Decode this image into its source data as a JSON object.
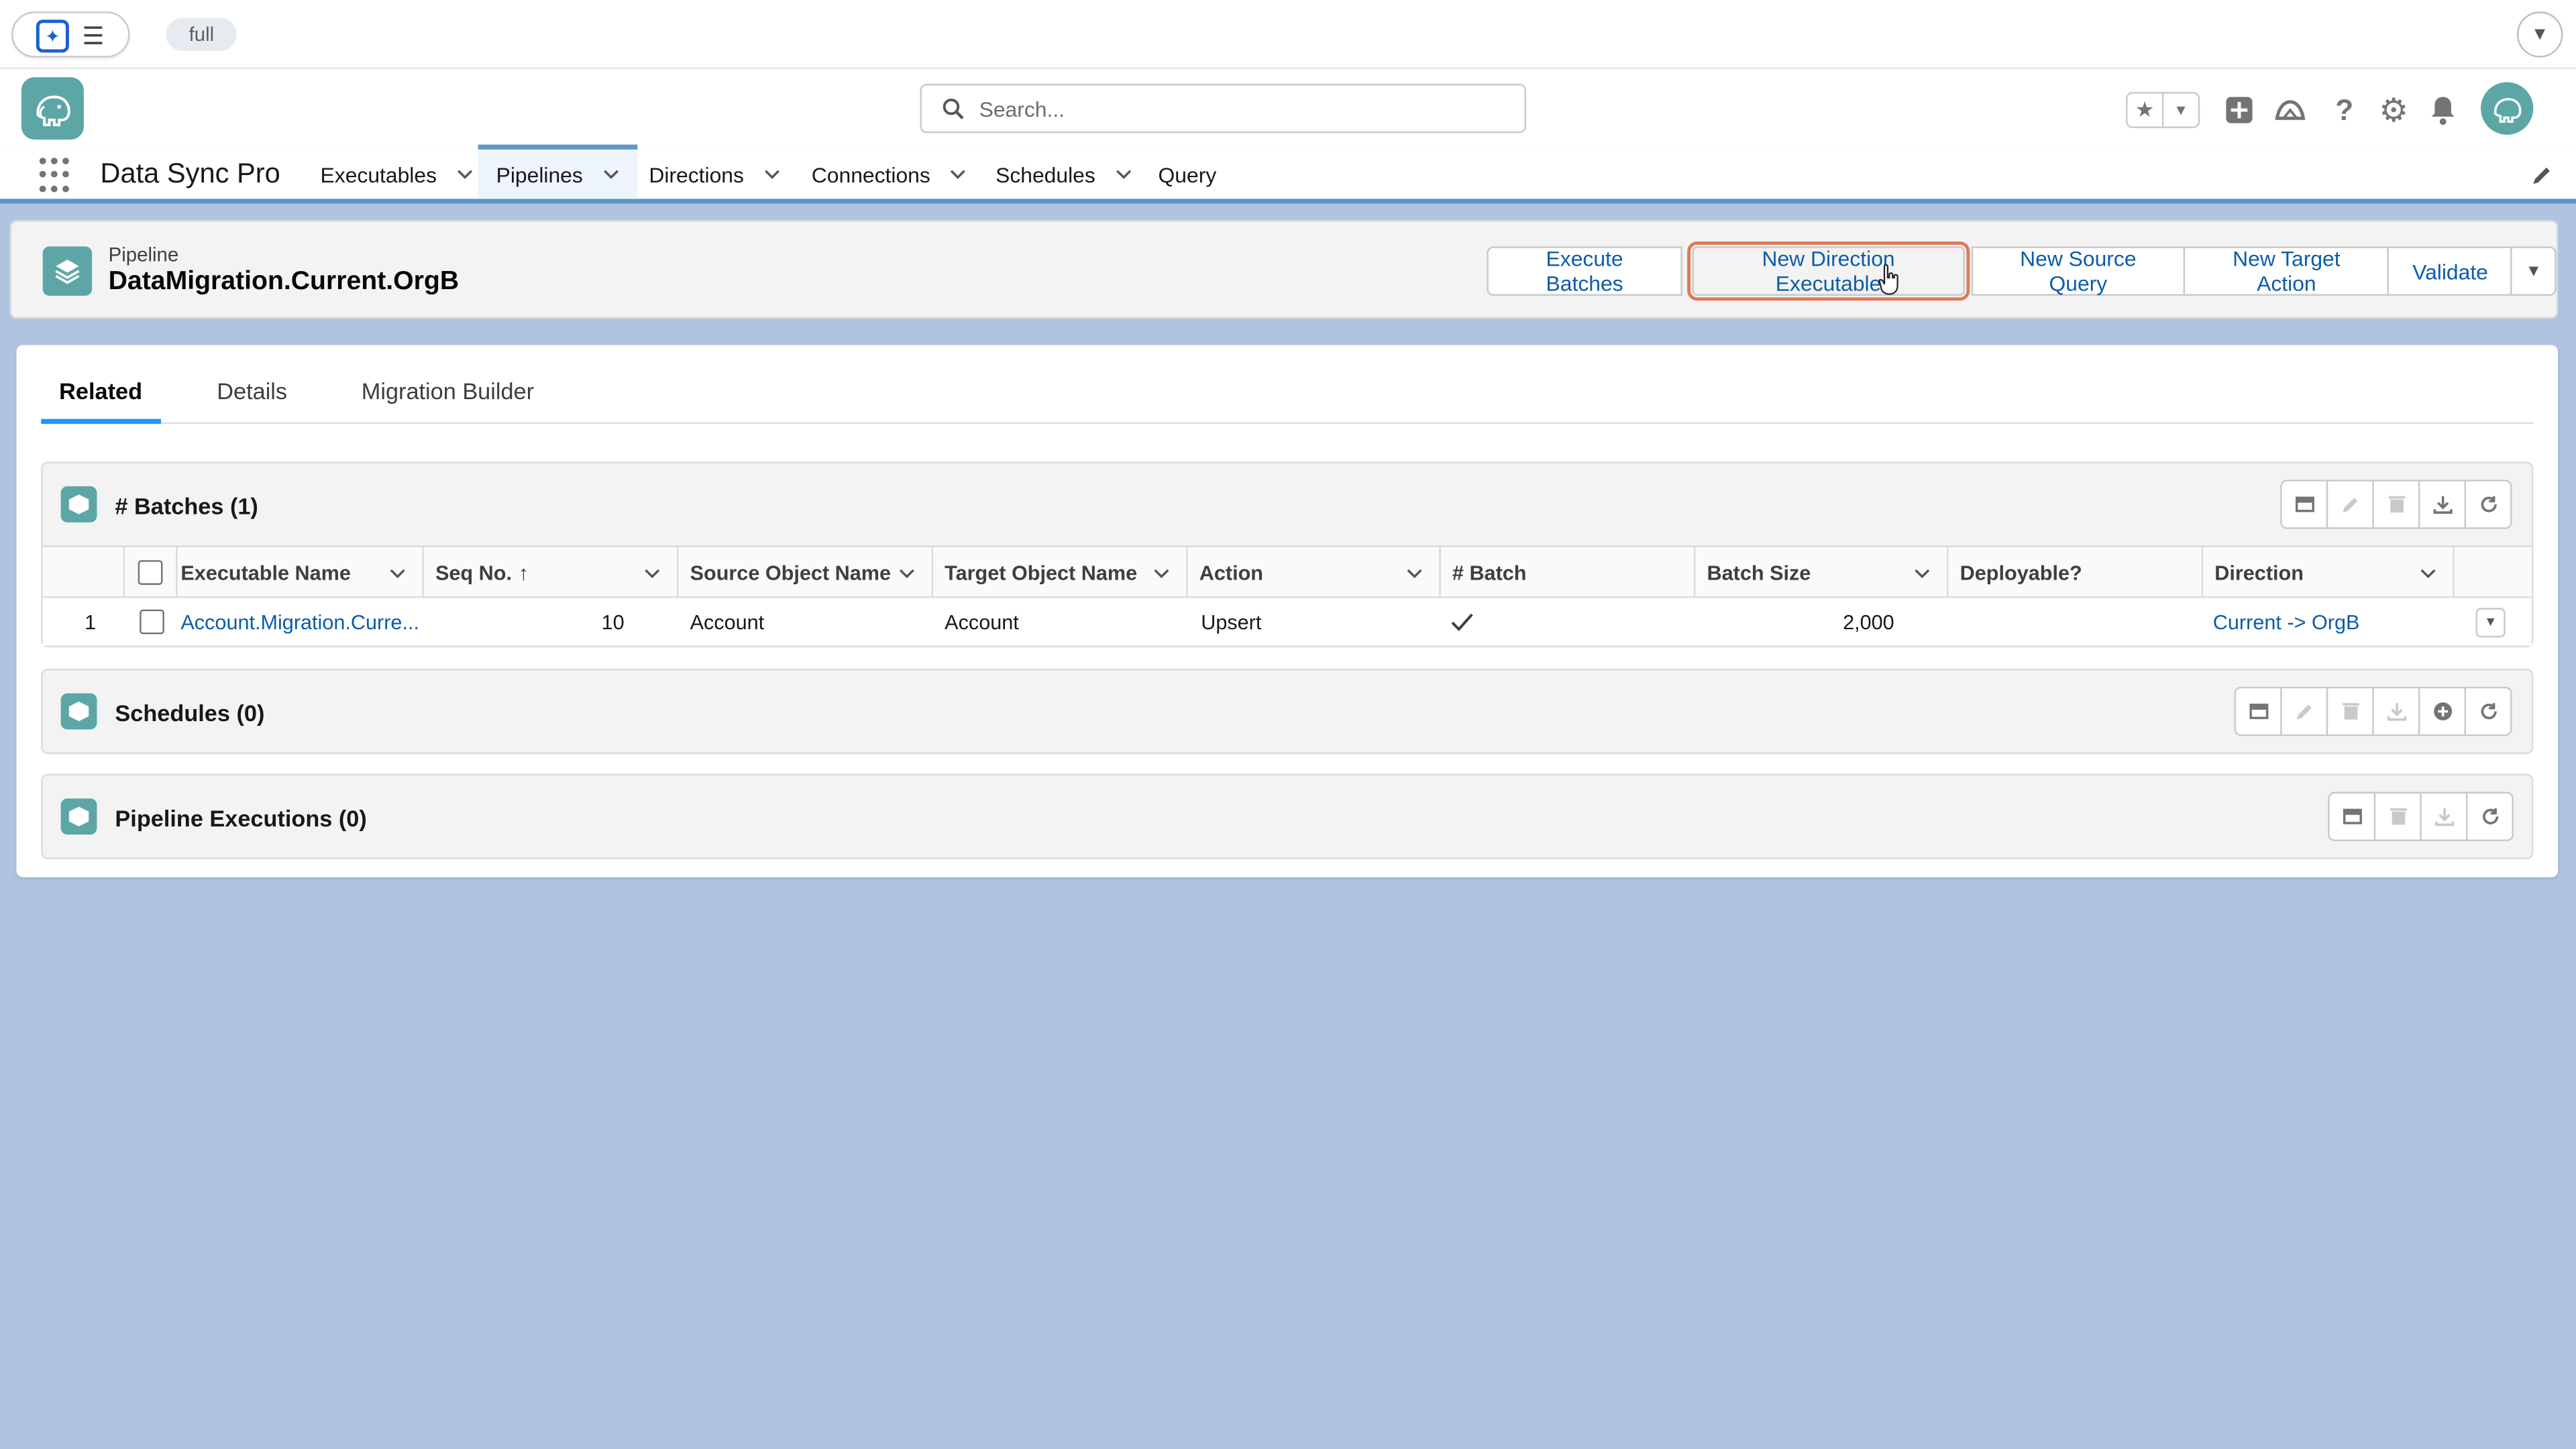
{
  "utility": {
    "environment_badge": "full"
  },
  "header": {
    "search_placeholder": "Search...",
    "icons": [
      "favorites-star-icon",
      "add-icon",
      "trailhead-icon",
      "help-icon",
      "setup-gear-icon",
      "notification-bell-icon",
      "user-avatar"
    ]
  },
  "nav": {
    "app_name": "Data Sync Pro",
    "items": [
      {
        "label": "Executables",
        "has_menu": true
      },
      {
        "label": "Pipelines",
        "has_menu": true,
        "active": true
      },
      {
        "label": "Directions",
        "has_menu": true
      },
      {
        "label": "Connections",
        "has_menu": true
      },
      {
        "label": "Schedules",
        "has_menu": true
      },
      {
        "label": "Query",
        "has_menu": false
      }
    ]
  },
  "record": {
    "object_type": "Pipeline",
    "name": "DataMigration.Current.OrgB",
    "actions": [
      "Execute Batches",
      "New Direction Executable",
      "New Source Query",
      "New Target Action",
      "Validate"
    ],
    "focused_action": "New Direction Executable"
  },
  "tabs": {
    "items": [
      "Related",
      "Details",
      "Migration Builder"
    ],
    "active": "Related"
  },
  "batches": {
    "title": "# Batches (1)",
    "columns": [
      "Executable Name",
      "Seq No.",
      "Source Object Name",
      "Target Object Name",
      "Action",
      "# Batch",
      "Batch Size",
      "Deployable?",
      "Direction"
    ],
    "sort_indicator": "↑",
    "rows": [
      {
        "row_number": "1",
        "executable_name": "Account.Migration.Curre...",
        "seq_no": "10",
        "source_object": "Account",
        "target_object": "Account",
        "action": "Upsert",
        "batch": true,
        "batch_size": "2,000",
        "deployable": "",
        "direction": "Current -> OrgB"
      }
    ]
  },
  "schedules": {
    "title": "Schedules (0)"
  },
  "executions": {
    "title": "Pipeline Executions (0)"
  },
  "colors": {
    "accent_teal": "#5ca7a6",
    "link_blue": "#0b5cab",
    "nav_active": "#5d97c7",
    "page_bg": "#b0c4df",
    "focus_ring": "#dd7a5a"
  }
}
